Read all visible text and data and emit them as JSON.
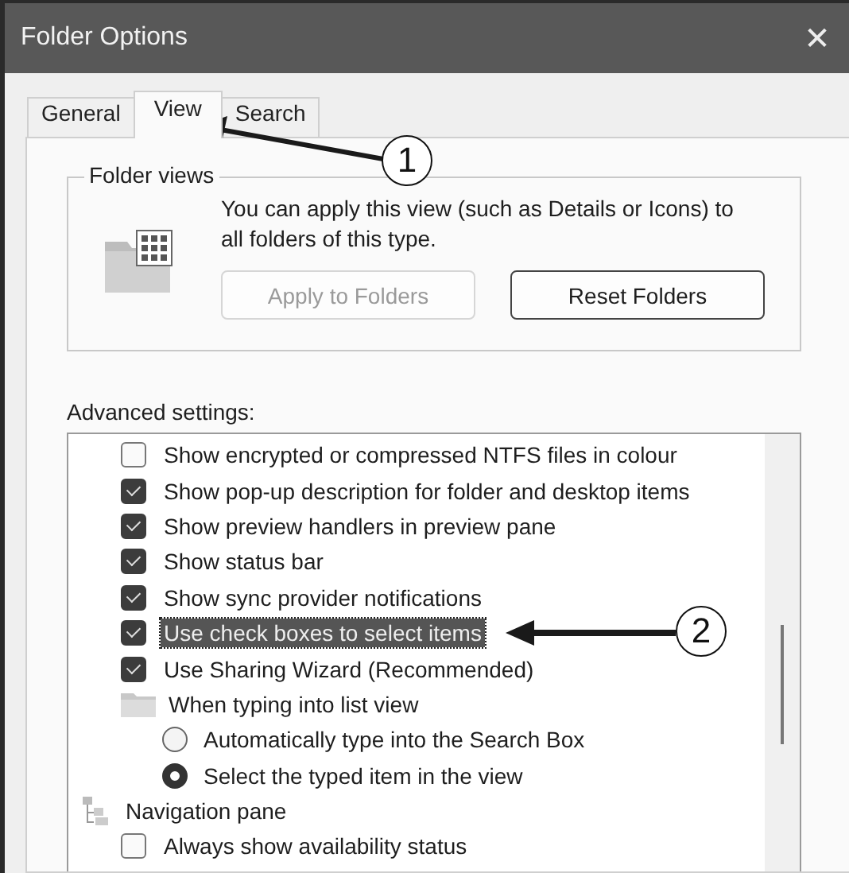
{
  "window": {
    "title": "Folder Options",
    "close": "✕"
  },
  "tabs": [
    {
      "label": "General",
      "selected": false
    },
    {
      "label": "View",
      "selected": true
    },
    {
      "label": "Search",
      "selected": false
    }
  ],
  "folder_views": {
    "title": "Folder views",
    "description": "You can apply this view (such as Details or Icons) to all folders of this type.",
    "buttons": [
      {
        "label": "Apply to Folders",
        "disabled": true
      },
      {
        "label": "Reset Folders",
        "disabled": false
      }
    ]
  },
  "advanced": {
    "label": "Advanced settings:",
    "items": [
      {
        "kind": "checkbox",
        "label": "Show encrypted or compressed NTFS files in colour",
        "checked": false,
        "selected": false
      },
      {
        "kind": "checkbox",
        "label": "Show pop-up description for folder and desktop items",
        "checked": true,
        "selected": false
      },
      {
        "kind": "checkbox",
        "label": "Show preview handlers in preview pane",
        "checked": true,
        "selected": false
      },
      {
        "kind": "checkbox",
        "label": "Show status bar",
        "checked": true,
        "selected": false
      },
      {
        "kind": "checkbox",
        "label": "Show sync provider notifications",
        "checked": true,
        "selected": false
      },
      {
        "kind": "checkbox",
        "label": "Use check boxes to select items",
        "checked": true,
        "selected": true
      },
      {
        "kind": "checkbox",
        "label": "Use Sharing Wizard (Recommended)",
        "checked": true,
        "selected": false
      },
      {
        "kind": "folder",
        "label": "When typing into list view",
        "selected": false,
        "children": [
          {
            "kind": "radio",
            "label": "Automatically type into the Search Box",
            "checked": false,
            "selected": false
          },
          {
            "kind": "radio",
            "label": "Select the typed item in the view",
            "checked": true,
            "selected": false
          }
        ]
      },
      {
        "kind": "group",
        "label": "Navigation pane",
        "selected": false,
        "children": [
          {
            "kind": "checkbox",
            "label": "Always show availability status",
            "checked": false,
            "selected": false
          }
        ]
      }
    ]
  },
  "callouts": [
    {
      "label": "1"
    },
    {
      "label": "2"
    }
  ]
}
